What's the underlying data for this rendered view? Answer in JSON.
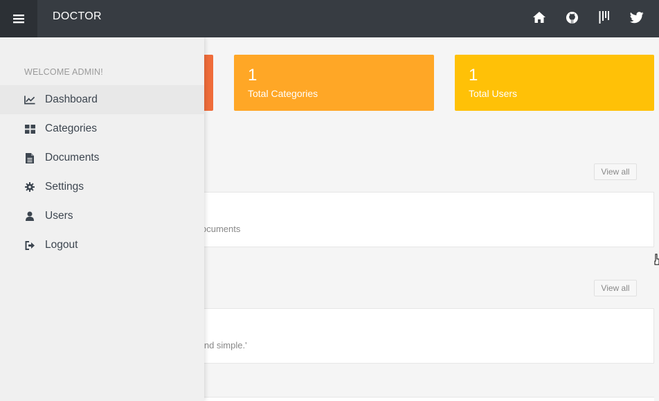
{
  "app": {
    "brand": "DOCTOR"
  },
  "topbar": {
    "menu_icon": "hamburger-icon",
    "icons": [
      "home-icon",
      "github-icon",
      "bars-logo-icon",
      "twitter-icon"
    ]
  },
  "sidebar": {
    "welcome": "WELCOME ADMIN!",
    "items": [
      {
        "label": "Dashboard",
        "icon": "line-chart-icon",
        "active": true
      },
      {
        "label": "Categories",
        "icon": "grid-icon"
      },
      {
        "label": "Documents",
        "icon": "document-icon"
      },
      {
        "label": "Settings",
        "icon": "gear-icon"
      },
      {
        "label": "Users",
        "icon": "user-icon"
      },
      {
        "label": "Logout",
        "icon": "sign-out-icon"
      }
    ]
  },
  "stats": [
    {
      "value": "1",
      "label": "Total Categories",
      "color": "#ffa726"
    },
    {
      "value": "1",
      "label": "Total Users",
      "color": "#ffc107"
    }
  ],
  "stat_partial_color": "#ef6c3a",
  "sections": [
    {
      "view_all": "View all",
      "snippet": "ocuments"
    },
    {
      "view_all": "View all",
      "snippet": "sy and simple.'"
    }
  ]
}
